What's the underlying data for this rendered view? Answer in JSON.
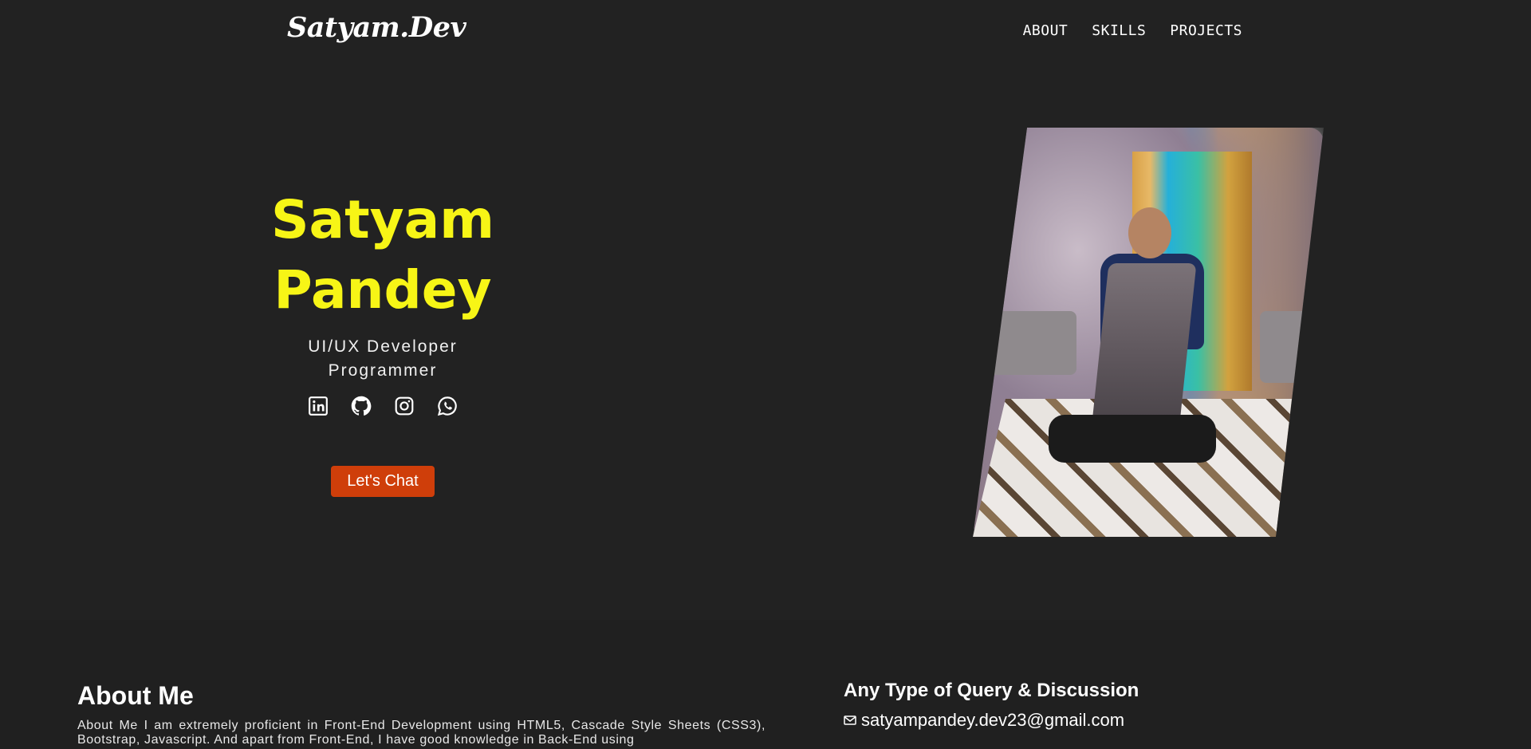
{
  "nav": {
    "brand": "Satyam.Dev",
    "links": [
      "ABOUT",
      "SKILLS",
      "PROJECTS"
    ]
  },
  "hero": {
    "name_line1": "Satyam",
    "name_line2": "Pandey",
    "role_line1": "UI/UX Developer",
    "role_line2": "Programmer",
    "social_icons": [
      "linkedin-icon",
      "github-icon",
      "instagram-icon",
      "whatsapp-icon"
    ],
    "cta_label": "Let's Chat"
  },
  "about": {
    "title": "About Me",
    "text": "About Me I am extremely proficient in Front-End Development using HTML5, Cascade Style Sheets (CSS3), Bootstrap, Javascript. And apart from Front-End, I have good knowledge in Back-End using"
  },
  "contact": {
    "title": "Any Type of Query & Discussion",
    "email": "satyampandey.dev23@gmail.com"
  },
  "colors": {
    "background": "#222222",
    "name_yellow": "#f7f516",
    "cta_orange": "#cf3e0a"
  }
}
